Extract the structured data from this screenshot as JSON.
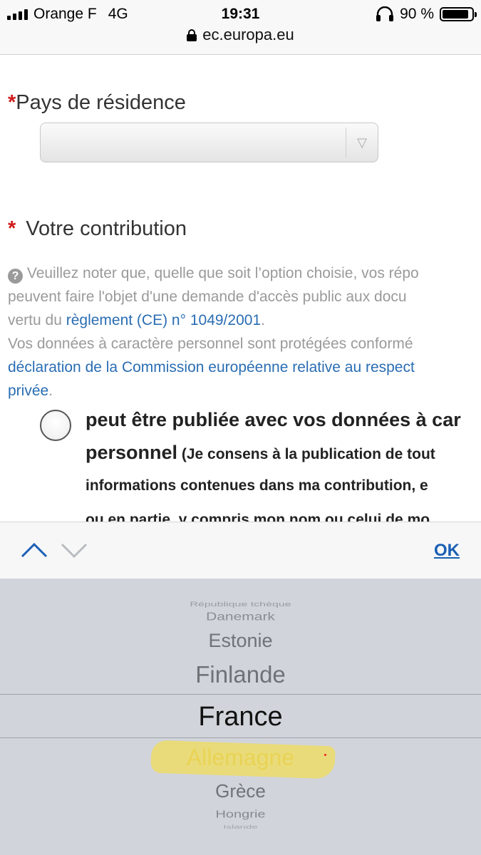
{
  "status_bar": {
    "carrier": "Orange F",
    "network": "4G",
    "time": "19:31",
    "battery": "90 %",
    "battery_level": 0.9,
    "url": "ec.europa.eu"
  },
  "form": {
    "required_mark": "*",
    "country_label": "Pays de résidence",
    "country_value": "",
    "contribution_label": "Votre contribution",
    "notice": {
      "line1": "Veuillez noter que, quelle que soit l’option choisie, vos répo",
      "line2": "peuvent faire l'objet d'une demande d'accès public aux docu",
      "line3_prefix": "vertu du ",
      "line3_link": "règlement (CE) n° 1049/2001",
      "line3_suffix": ".",
      "line4": "Vos données à caractère personnel sont protégées conformé",
      "line5_link": "déclaration de la Commission européenne relative au respect",
      "line6_link": "privée",
      "line6_suffix": "."
    },
    "option": {
      "line1": "peut être publiée avec vos données à car",
      "line2_bold": "personnel",
      "line2_rest": " (Je consens à la publication de tout",
      "line3": "informations contenues dans ma contribution, e",
      "line4": "ou en partie, y compris mon nom ou celui de mo"
    }
  },
  "toolbar": {
    "ok_label": "OK"
  },
  "picker": {
    "items": [
      "République tchèque",
      "Danemark",
      "Estonie",
      "Finlande",
      "France",
      "Allemagne",
      "Grèce",
      "Hongrie",
      "Islande"
    ],
    "selected": "France",
    "highlighted": "Allemagne",
    "highlight_color": "#f1de5a"
  },
  "colors": {
    "accent": "#1a5fb4",
    "link": "#2a6db3",
    "required": "#d01b1b"
  }
}
